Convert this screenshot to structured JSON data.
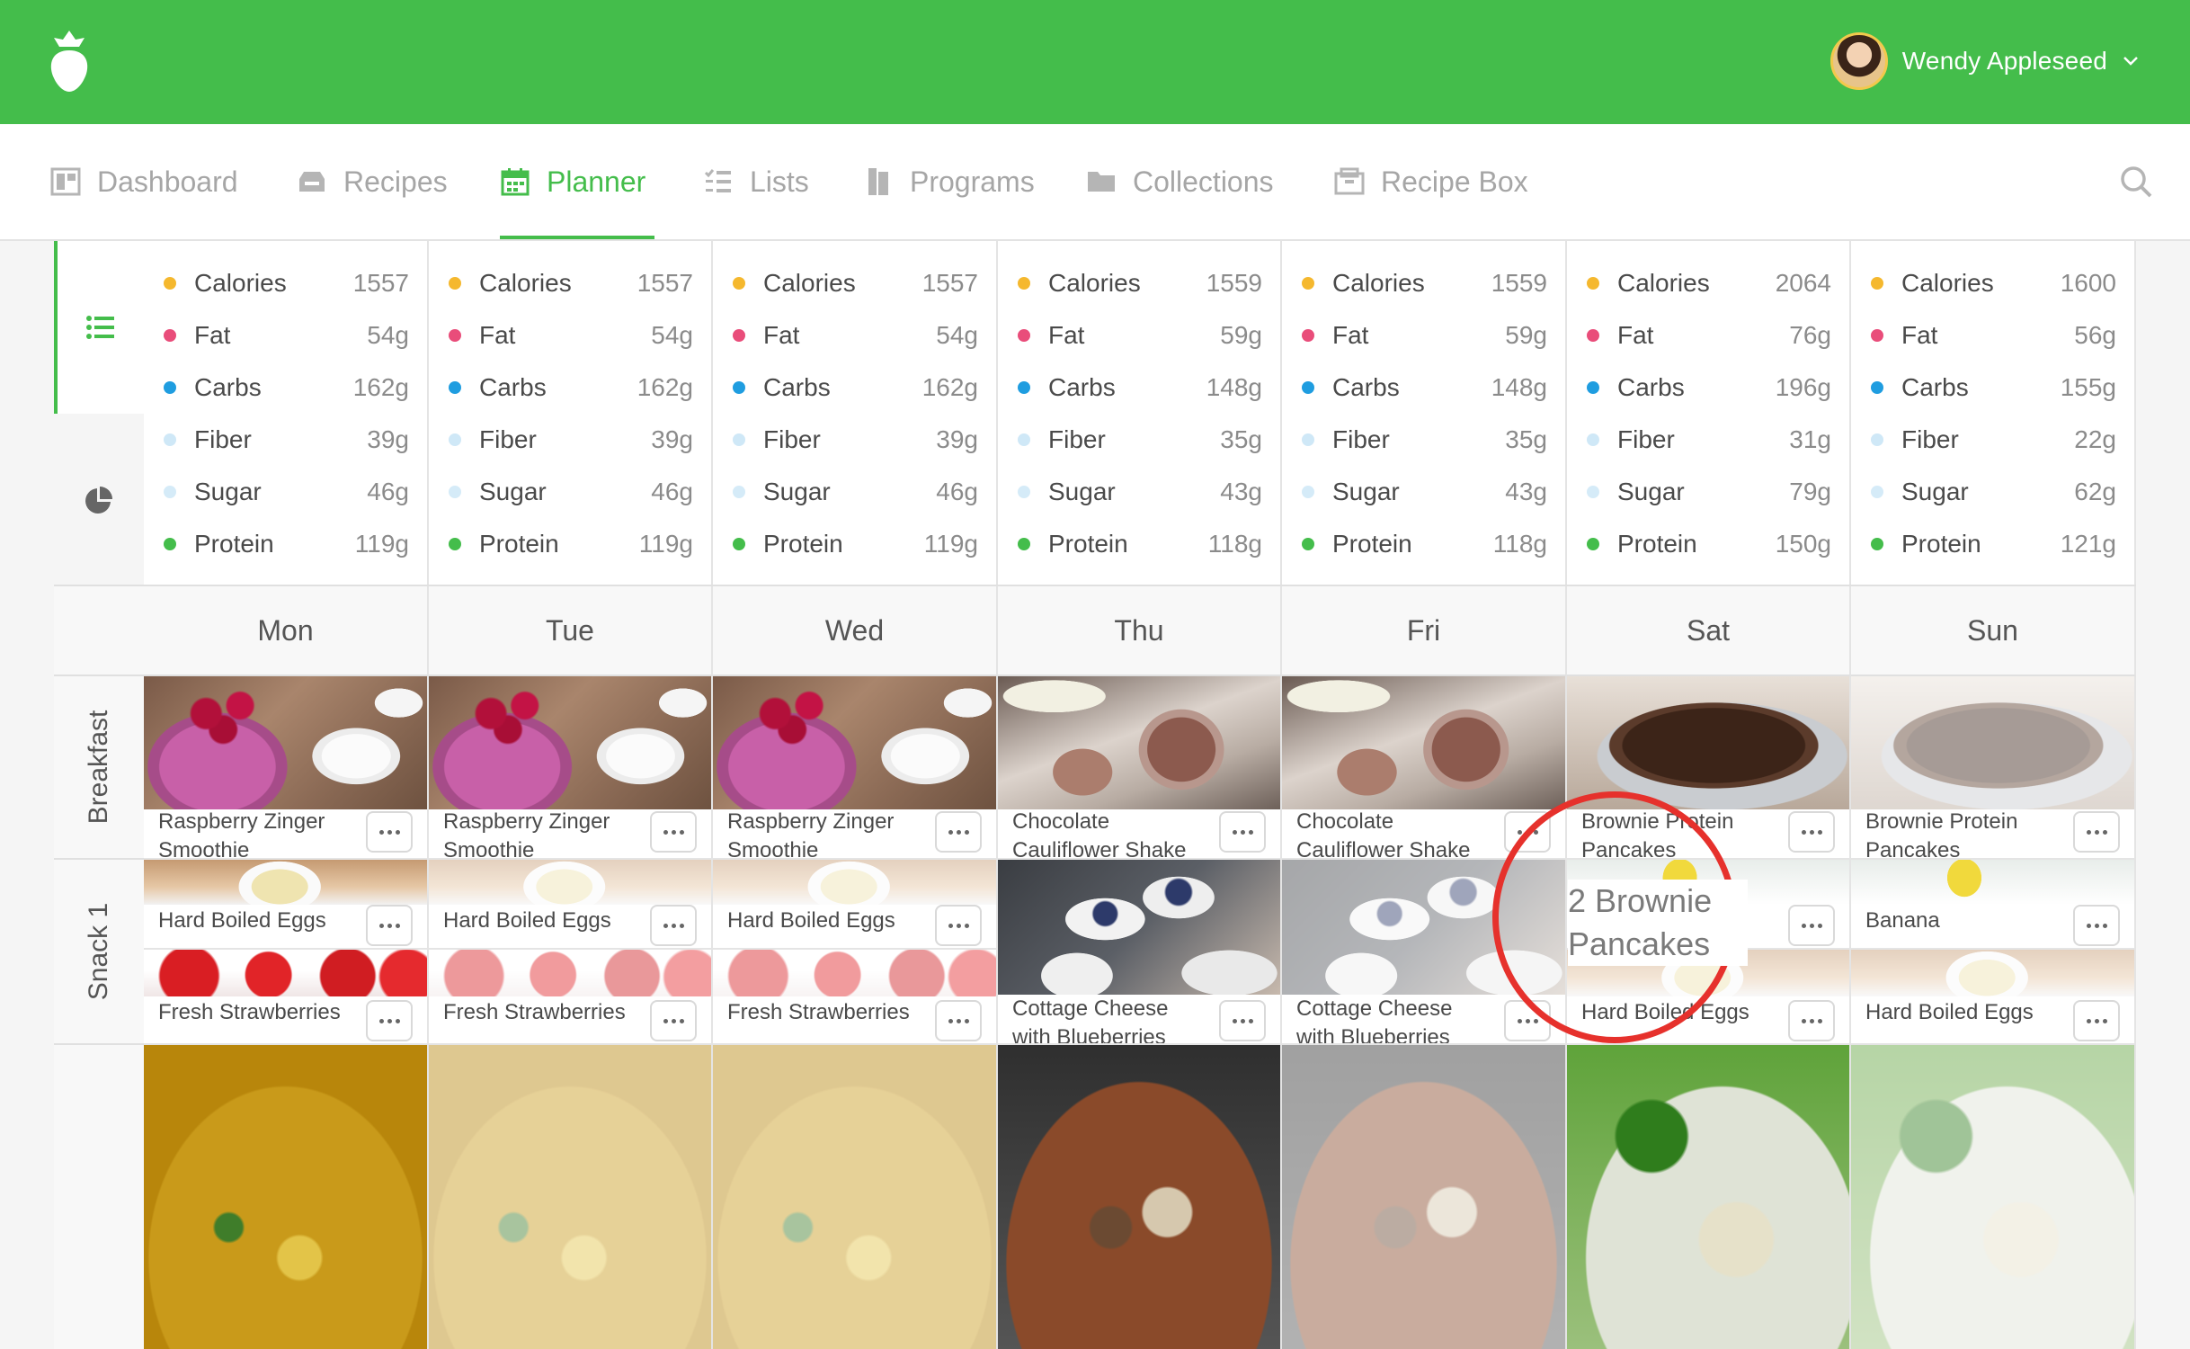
{
  "app": {
    "user_name": "Wendy Appleseed",
    "brand_color": "#44bd4b",
    "icons": {
      "logo": "strawberry-logo",
      "user_menu": "chevron-down-icon",
      "search": "search-icon"
    }
  },
  "nav": {
    "items": [
      {
        "label": "Dashboard",
        "icon": "dashboard-icon",
        "active": false
      },
      {
        "label": "Recipes",
        "icon": "recipes-icon",
        "active": false
      },
      {
        "label": "Planner",
        "icon": "calendar-icon",
        "active": true
      },
      {
        "label": "Lists",
        "icon": "list-icon",
        "active": false
      },
      {
        "label": "Programs",
        "icon": "programs-icon",
        "active": false
      },
      {
        "label": "Collections",
        "icon": "folder-icon",
        "active": false
      },
      {
        "label": "Recipe Box",
        "icon": "recipe-box-icon",
        "active": false
      }
    ]
  },
  "side_tabs": [
    {
      "icon": "list-view-icon",
      "active": true
    },
    {
      "icon": "pie-chart-icon",
      "active": false
    }
  ],
  "nutrient_colors": {
    "Calories": "#f5b82e",
    "Fat": "#e94d7a",
    "Carbs": "#1f9de0",
    "Fiber": "#cfe8f7",
    "Sugar": "#d5ebf8",
    "Protein": "#44bd4b"
  },
  "days": [
    {
      "label": "Mon",
      "nutrition": [
        [
          "Calories",
          "1557"
        ],
        [
          "Fat",
          "54g"
        ],
        [
          "Carbs",
          "162g"
        ],
        [
          "Fiber",
          "39g"
        ],
        [
          "Sugar",
          "46g"
        ],
        [
          "Protein",
          "119g"
        ]
      ]
    },
    {
      "label": "Tue",
      "nutrition": [
        [
          "Calories",
          "1557"
        ],
        [
          "Fat",
          "54g"
        ],
        [
          "Carbs",
          "162g"
        ],
        [
          "Fiber",
          "39g"
        ],
        [
          "Sugar",
          "46g"
        ],
        [
          "Protein",
          "119g"
        ]
      ]
    },
    {
      "label": "Wed",
      "nutrition": [
        [
          "Calories",
          "1557"
        ],
        [
          "Fat",
          "54g"
        ],
        [
          "Carbs",
          "162g"
        ],
        [
          "Fiber",
          "39g"
        ],
        [
          "Sugar",
          "46g"
        ],
        [
          "Protein",
          "119g"
        ]
      ]
    },
    {
      "label": "Thu",
      "nutrition": [
        [
          "Calories",
          "1559"
        ],
        [
          "Fat",
          "59g"
        ],
        [
          "Carbs",
          "148g"
        ],
        [
          "Fiber",
          "35g"
        ],
        [
          "Sugar",
          "43g"
        ],
        [
          "Protein",
          "118g"
        ]
      ]
    },
    {
      "label": "Fri",
      "nutrition": [
        [
          "Calories",
          "1559"
        ],
        [
          "Fat",
          "59g"
        ],
        [
          "Carbs",
          "148g"
        ],
        [
          "Fiber",
          "35g"
        ],
        [
          "Sugar",
          "43g"
        ],
        [
          "Protein",
          "118g"
        ]
      ]
    },
    {
      "label": "Sat",
      "nutrition": [
        [
          "Calories",
          "2064"
        ],
        [
          "Fat",
          "76g"
        ],
        [
          "Carbs",
          "196g"
        ],
        [
          "Fiber",
          "31g"
        ],
        [
          "Sugar",
          "79g"
        ],
        [
          "Protein",
          "150g"
        ]
      ]
    },
    {
      "label": "Sun",
      "nutrition": [
        [
          "Calories",
          "1600"
        ],
        [
          "Fat",
          "56g"
        ],
        [
          "Carbs",
          "155g"
        ],
        [
          "Fiber",
          "22g"
        ],
        [
          "Sugar",
          "62g"
        ],
        [
          "Protein",
          "121g"
        ]
      ]
    }
  ],
  "meals": [
    {
      "label": "Breakfast"
    },
    {
      "label": "Snack 1"
    }
  ],
  "breakfast": [
    {
      "title": "Raspberry Zinger Smoothie",
      "img": "smoothie",
      "faded": false
    },
    {
      "title": "Raspberry Zinger Smoothie",
      "img": "smoothie",
      "faded": false
    },
    {
      "title": "Raspberry Zinger Smoothie",
      "img": "smoothie",
      "faded": false
    },
    {
      "title": "Chocolate Cauliflower Shake",
      "img": "choc",
      "faded": false
    },
    {
      "title": "Chocolate Cauliflower Shake",
      "img": "choc",
      "faded": false
    },
    {
      "title": "Brownie Protein Pancakes",
      "img": "pancake",
      "faded": false
    },
    {
      "title": "Brownie Protein Pancakes",
      "img": "pancake",
      "faded": true
    }
  ],
  "snack_a": [
    {
      "title": "Hard Boiled Eggs",
      "img": "egg",
      "faded": false
    },
    {
      "title": "Hard Boiled Eggs",
      "img": "egg",
      "faded": true
    },
    {
      "title": "Hard Boiled Eggs",
      "img": "egg",
      "faded": true
    },
    {
      "title": "Cottage Cheese with Blueberries",
      "img": "cottage",
      "faded": false
    },
    {
      "title": "Cottage Cheese with Blueberries",
      "img": "cottage",
      "faded": true
    },
    {
      "title": "Banana",
      "img": "banana",
      "faded": false
    },
    {
      "title": "Banana",
      "img": "banana",
      "faded": false
    }
  ],
  "snack_b": [
    {
      "title": "Fresh Strawberries",
      "img": "straw",
      "faded": false
    },
    {
      "title": "Fresh Strawberries",
      "img": "straw",
      "faded": true
    },
    {
      "title": "Fresh Strawberries",
      "img": "straw",
      "faded": true
    },
    null,
    null,
    {
      "title": "Hard Boiled Eggs",
      "img": "egg",
      "faded": true
    },
    {
      "title": "Hard Boiled Eggs",
      "img": "egg",
      "faded": true
    }
  ],
  "lunch_images": [
    {
      "img": "curry",
      "faded": false
    },
    {
      "img": "curry",
      "faded": true
    },
    {
      "img": "curry",
      "faded": true
    },
    {
      "img": "bowl",
      "faded": false
    },
    {
      "img": "bowl",
      "faded": true
    },
    {
      "img": "salad",
      "faded": false
    },
    {
      "img": "salad",
      "faded": true
    }
  ],
  "callout": {
    "text": "2 Brownie Pancakes",
    "color": "#e6312c"
  }
}
